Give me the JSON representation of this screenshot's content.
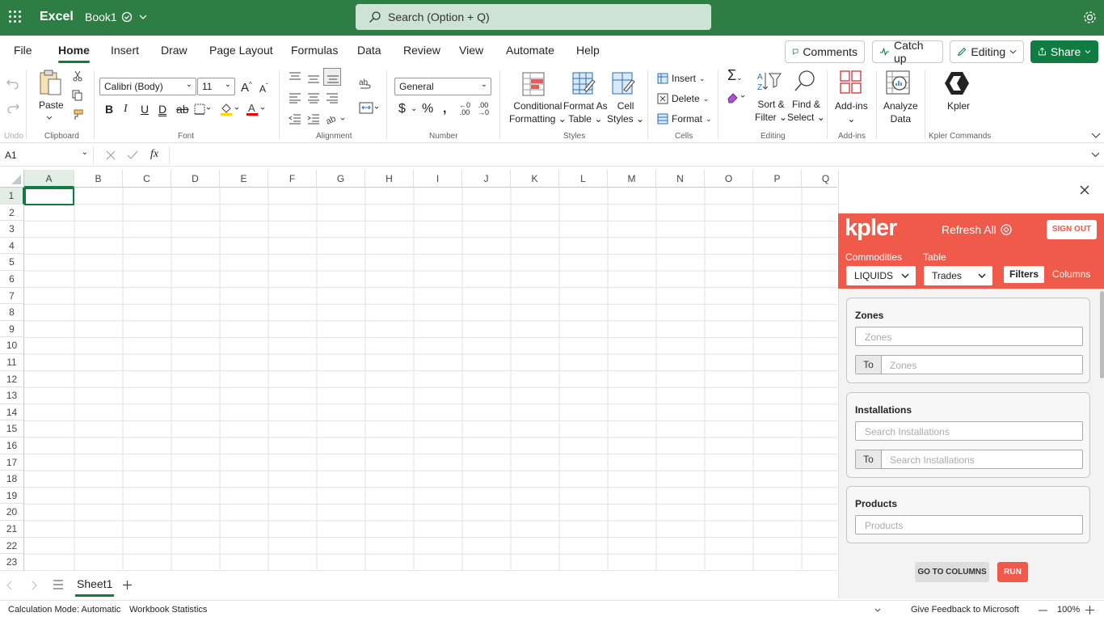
{
  "app": {
    "name": "Excel",
    "workbook": "Book1"
  },
  "search": {
    "placeholder": "Search (Option + Q)"
  },
  "tabs": [
    "File",
    "Home",
    "Insert",
    "Draw",
    "Page Layout",
    "Formulas",
    "Data",
    "Review",
    "View",
    "Automate",
    "Help"
  ],
  "active_tab": "Home",
  "header_buttons": {
    "comments": "Comments",
    "catchup": "Catch up",
    "editing": "Editing",
    "share": "Share"
  },
  "ribbon": {
    "undo_label": "Undo",
    "paste": "Paste",
    "clipboard": "Clipboard",
    "font_name": "Calibri (Body)",
    "font_size": "11",
    "font_label": "Font",
    "alignment_label": "Alignment",
    "number_format": "General",
    "number_label": "Number",
    "cond_format": [
      "Conditional",
      "Formatting"
    ],
    "format_table": [
      "Format As",
      "Table"
    ],
    "cell_styles": [
      "Cell",
      "Styles"
    ],
    "styles_label": "Styles",
    "insert": "Insert",
    "delete": "Delete",
    "format": "Format",
    "cells_label": "Cells",
    "sort_filter": [
      "Sort &",
      "Filter"
    ],
    "find_select": [
      "Find &",
      "Select"
    ],
    "editing_label": "Editing",
    "addins": "Add-ins",
    "addins_label": "Add-ins",
    "analyze": [
      "Analyze",
      "Data"
    ],
    "kpler": "Kpler",
    "kpler_label": "Kpler Commands"
  },
  "formula_bar": {
    "name_box": "A1",
    "fx": "fx",
    "value": ""
  },
  "columns": [
    "A",
    "B",
    "C",
    "D",
    "E",
    "F",
    "G",
    "H",
    "I",
    "J",
    "K",
    "L",
    "M",
    "N",
    "O",
    "P",
    "Q"
  ],
  "rows": [
    "1",
    "2",
    "3",
    "4",
    "5",
    "6",
    "7",
    "8",
    "9",
    "10",
    "11",
    "12",
    "13",
    "14",
    "15",
    "16",
    "17",
    "18",
    "19",
    "20",
    "21",
    "22",
    "23"
  ],
  "sheets": {
    "active": "Sheet1"
  },
  "status": {
    "calc": "Calculation Mode: Automatic",
    "stats": "Workbook Statistics",
    "feedback": "Give Feedback to Microsoft",
    "zoom": "100%"
  },
  "kpler": {
    "logo": "kpler",
    "refresh": "Refresh All",
    "sign_out": "SIGN OUT",
    "commodities_label": "Commodities",
    "commodity": "LIQUIDS",
    "table_label": "Table",
    "table": "Trades",
    "filters": "Filters",
    "columns": "Columns",
    "zones_title": "Zones",
    "zones_ph": "Zones",
    "to": "To",
    "zones_to_ph": "Zones",
    "inst_title": "Installations",
    "inst_ph": "Search Installations",
    "inst_to_ph": "Search Installations",
    "products_title": "Products",
    "products_ph": "Products",
    "go_columns": "GO TO COLUMNS",
    "run": "RUN"
  },
  "colors": {
    "excel_green": "#2e7d45",
    "kpler_red": "#ef5a4a",
    "accent": "#107c41"
  }
}
